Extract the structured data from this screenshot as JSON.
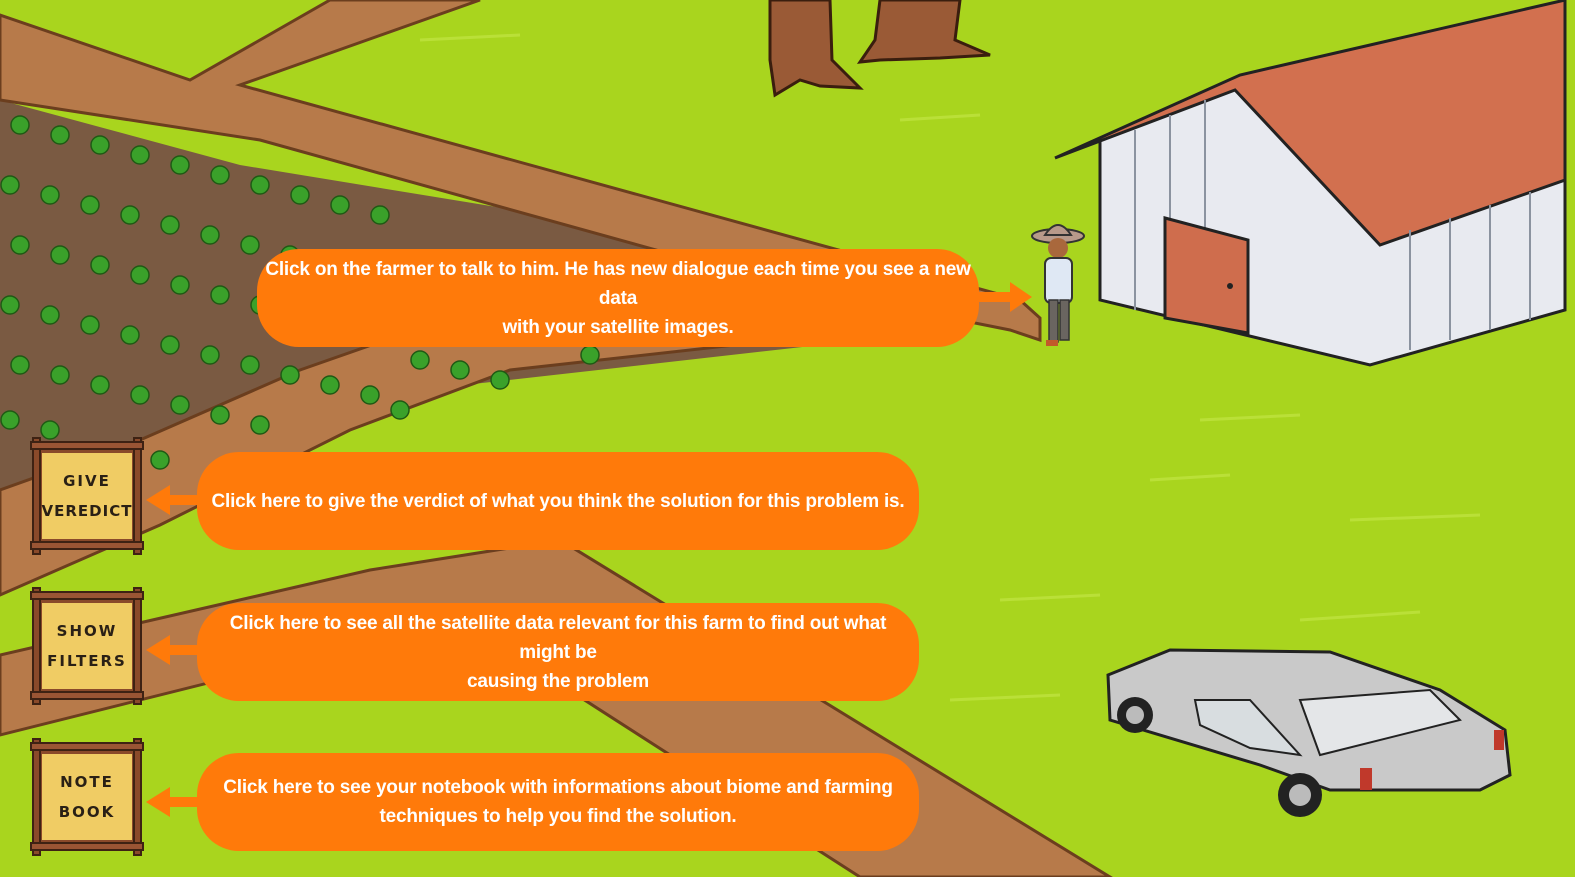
{
  "tips": {
    "farmer": {
      "line1": "Click on the farmer to talk to him. He has new dialogue each time you see a new data",
      "line2": "with your satellite images."
    },
    "verdict": "Click here to give the verdict of what you think the solution for this problem is.",
    "filters": {
      "line1": "Click here to see all the satellite data relevant for this farm to find out what might be",
      "line2": "causing the problem"
    },
    "notebook": {
      "line1": "Click here to see your notebook with informations about biome and farming",
      "line2": "techniques to help you find the solution."
    }
  },
  "buttons": {
    "verdict": {
      "line1": "GIVE",
      "line2": "VEREDICT"
    },
    "filters": {
      "line1": "SHOW",
      "line2": "FILTERS"
    },
    "notebook": {
      "line1": "NOTE",
      "line2": "BOOK"
    }
  },
  "colors": {
    "grass": "#a9d51e",
    "dirt_road": "#b77a4a",
    "soil": "#7a5a42",
    "tip_bubble": "#ff7a0a",
    "barn_roof": "#d2704f",
    "barn_wall": "#e8eaf0",
    "sign_board": "#f0cc64",
    "sign_wood": "#8a4a2a",
    "car": "#c9c9c9"
  }
}
